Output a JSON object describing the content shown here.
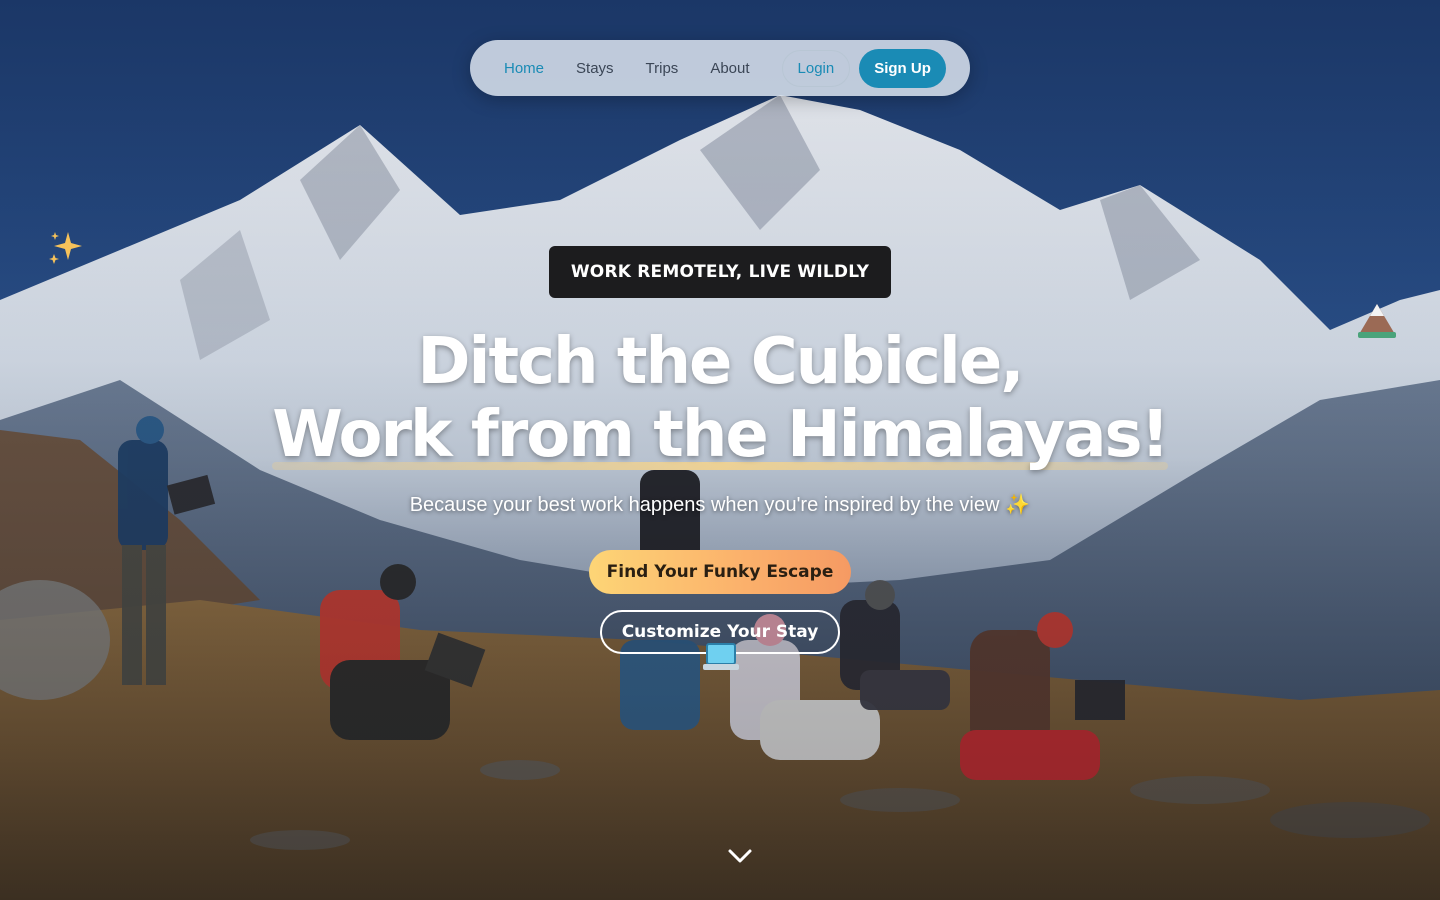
{
  "nav": {
    "links": [
      "Home",
      "Stays",
      "Trips",
      "About"
    ],
    "active": "Home",
    "login_label": "Login",
    "signup_label": "Sign Up"
  },
  "hero": {
    "badge": "WORK REMOTELY, LIVE WILDLY",
    "headline_line1": "Ditch the Cubicle,",
    "headline_line2": "Work from the Himalayas!",
    "subtitle": "Because your best work happens when you're inspired by the view",
    "subtitle_emoji": "✨",
    "primary_cta": "Find Your Funky Escape",
    "secondary_cta": "Customize Your Stay"
  },
  "icons": {
    "sparkle": "sparkle-icon",
    "mountain": "mountain-icon",
    "laptop": "laptop-icon",
    "scroll": "chevron-down-icon"
  },
  "colors": {
    "accent": "#1a8bb5",
    "badge_bg": "#1c1c1e",
    "cta_gradient_start": "#fdd576",
    "cta_gradient_end": "#f59a63"
  }
}
